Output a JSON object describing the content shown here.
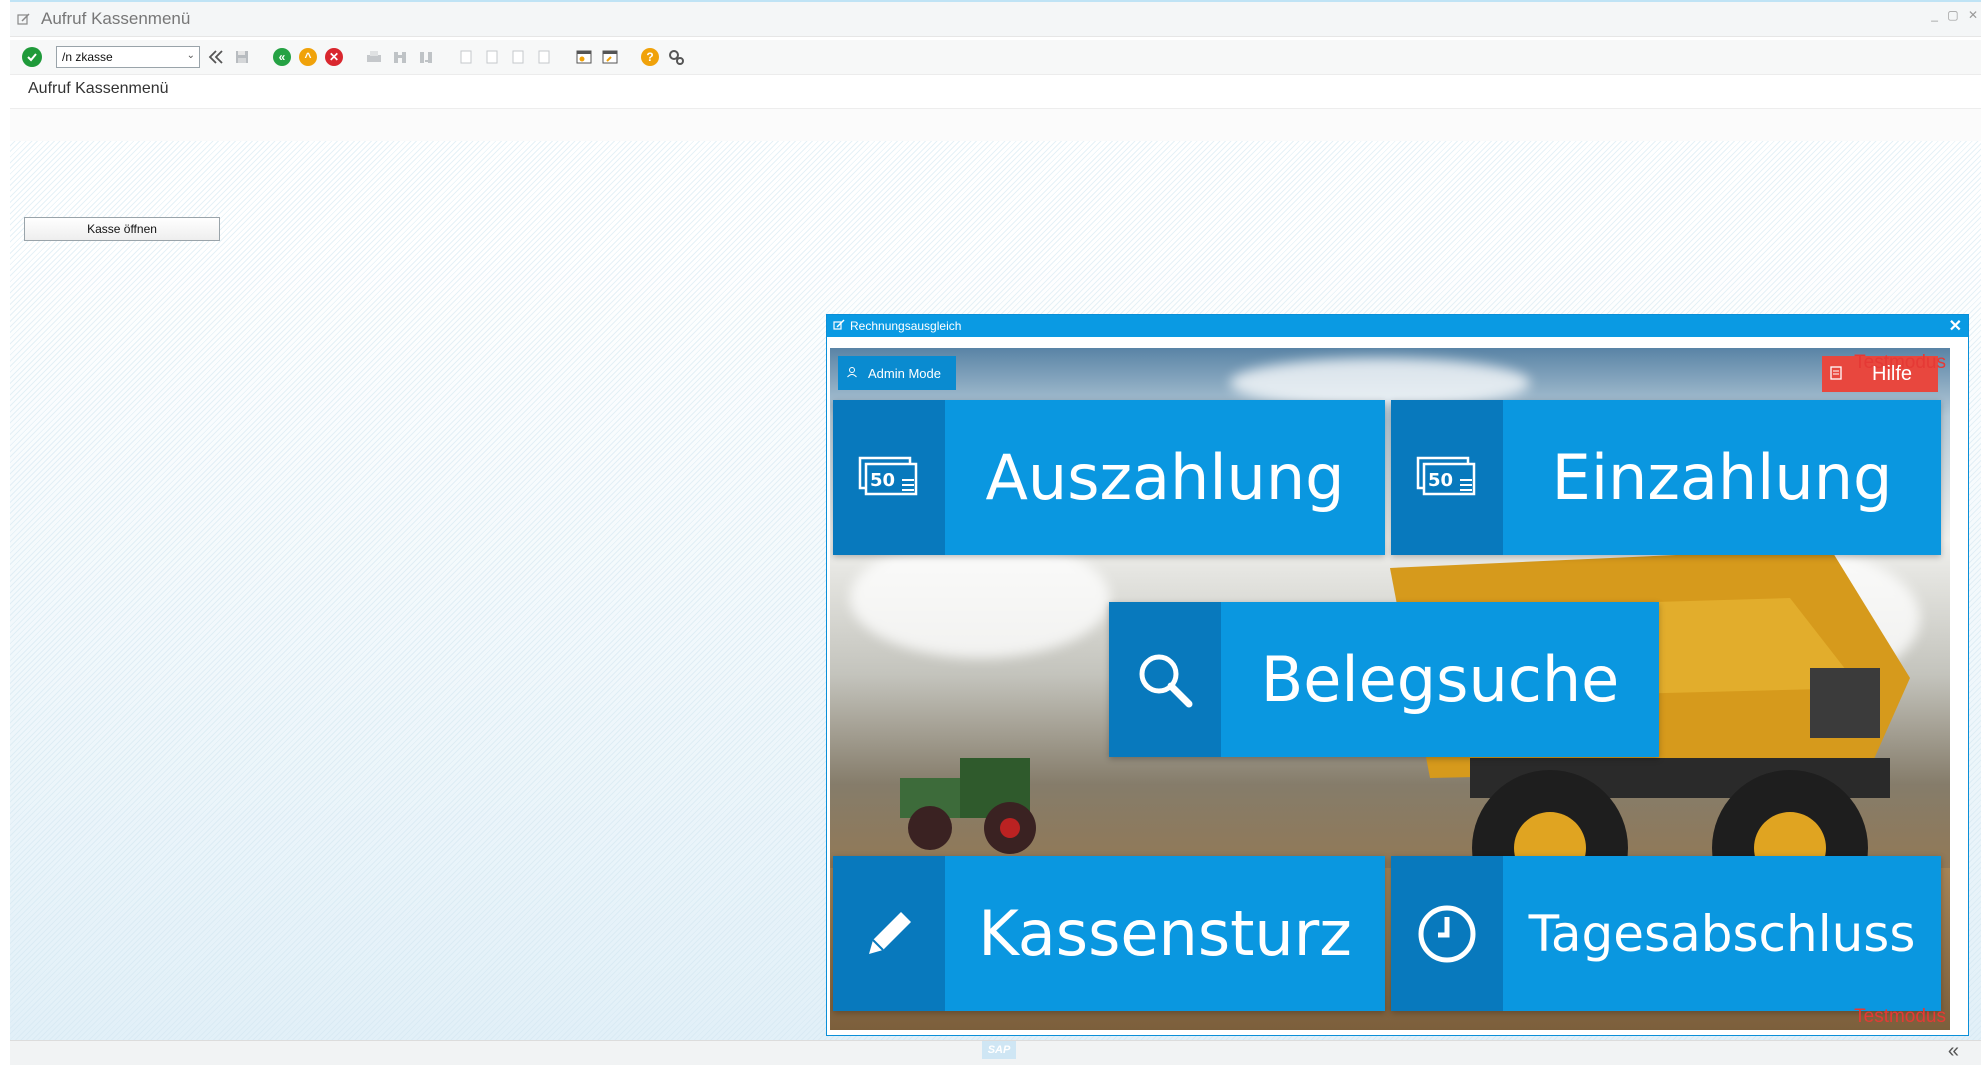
{
  "window": {
    "title": "Aufruf Kassenmenü"
  },
  "toolbar": {
    "command_value": "/n zkasse"
  },
  "screen": {
    "title": "Aufruf Kassenmenü",
    "open_register_label": "Kasse öffnen"
  },
  "popup": {
    "title": "Rechnungsausgleich",
    "admin_label": "Admin Mode",
    "help_label": "Hilfe",
    "testmode_label": "Testmodus",
    "tiles": {
      "auszahlung": "Auszahlung",
      "einzahlung": "Einzahlung",
      "belegsuche": "Belegsuche",
      "kassensturz": "Kassensturz",
      "tagesabschluss": "Tagesabschluss"
    },
    "bill_icon_value": "50"
  },
  "status": {
    "logo": "SAP"
  },
  "colors": {
    "tile_blue": "#0a97e0",
    "tile_icon_blue": "#0879bd",
    "help_red": "#e8473e",
    "header_blue": "#0a9ae3"
  }
}
